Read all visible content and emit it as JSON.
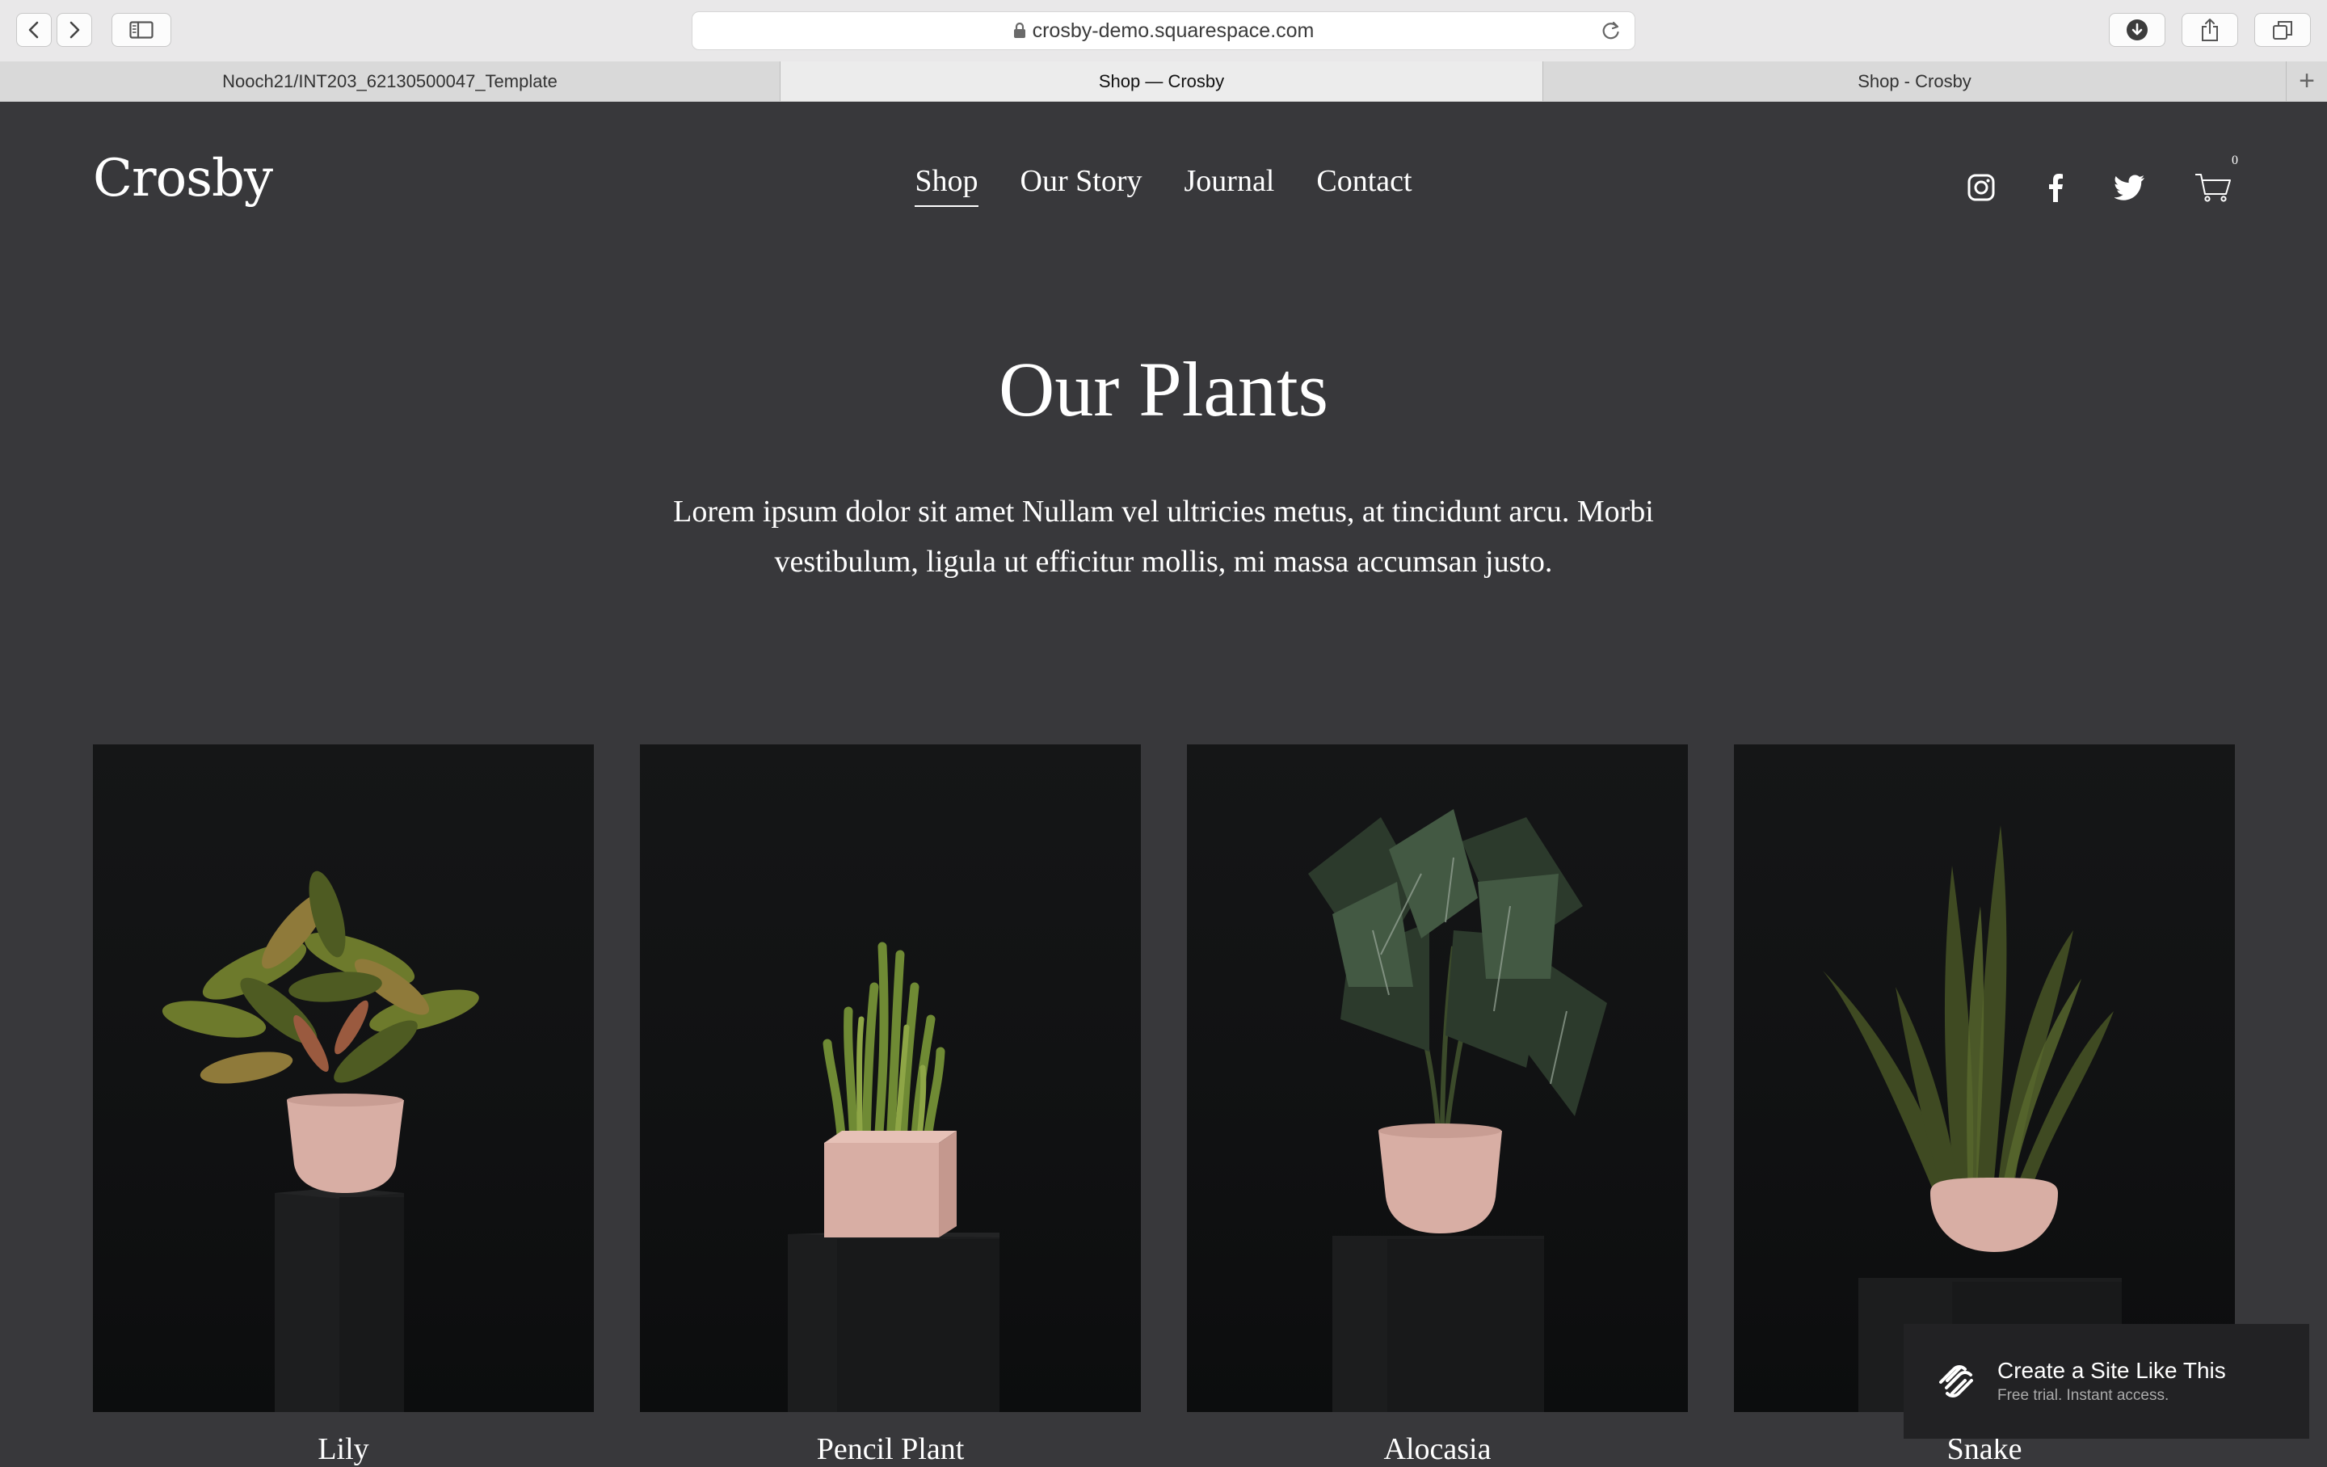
{
  "browser": {
    "url": "crosby-demo.squarespace.com",
    "tabs": [
      {
        "label": "Nooch21/INT203_62130500047_Template",
        "active": false
      },
      {
        "label": "Shop — Crosby",
        "active": true
      },
      {
        "label": "Shop - Crosby",
        "active": false
      }
    ],
    "new_tab": "+"
  },
  "site": {
    "logo": "Crosby",
    "nav": [
      {
        "label": "Shop",
        "active": true
      },
      {
        "label": "Our Story",
        "active": false
      },
      {
        "label": "Journal",
        "active": false
      },
      {
        "label": "Contact",
        "active": false
      }
    ],
    "social_icons": [
      "instagram-icon",
      "facebook-icon",
      "twitter-icon"
    ],
    "cart_count": "0"
  },
  "hero": {
    "title": "Our Plants",
    "description": "Lorem ipsum dolor sit amet Nullam vel ultricies metus, at tincidunt arcu. Morbi vestibulum, ligula ut efficitur mollis, mi massa accumsan justo."
  },
  "products": [
    {
      "name": "Lily"
    },
    {
      "name": "Pencil Plant"
    },
    {
      "name": "Alocasia"
    },
    {
      "name": "Snake"
    }
  ],
  "promo": {
    "title": "Create a Site Like This",
    "subtitle": "Free trial. Instant access."
  },
  "colors": {
    "page_background": "#38383b",
    "pot_pink": "#d8aea4",
    "card_background": "#121314"
  }
}
